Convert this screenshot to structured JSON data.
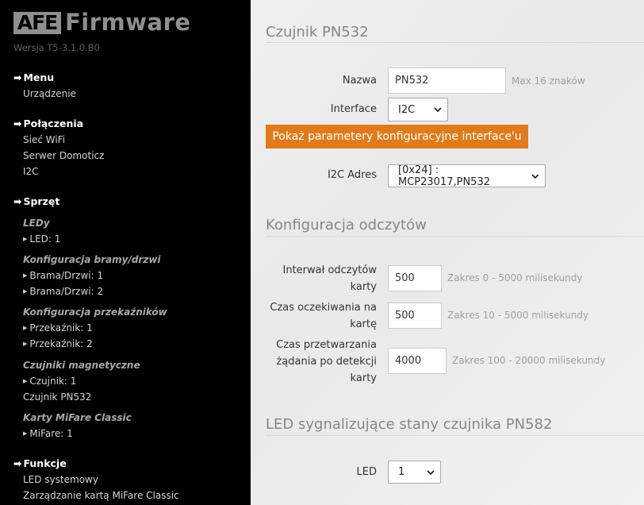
{
  "sidebar": {
    "logo_box": "AFE",
    "logo_word": "Firmware",
    "version": "Wersja T5-3.1.0.B0",
    "sections": {
      "menu": {
        "title": "Menu",
        "items": [
          "Urządzenie"
        ]
      },
      "connections": {
        "title": "Połączenia",
        "items": [
          "Sieć WiFi",
          "Serwer Domoticz",
          "I2C"
        ]
      },
      "hardware": {
        "title": "Sprzęt",
        "groups": [
          {
            "title": "LEDy",
            "items": [
              "LED: 1"
            ]
          },
          {
            "title": "Konfiguracja bramy/drzwi",
            "items": [
              "Brama/Drzwi: 1",
              "Brama/Drzwi: 2"
            ]
          },
          {
            "title": "Konfiguracja przekaźników",
            "items": [
              "Przekaźnik: 1",
              "Przekaźnik: 2"
            ]
          },
          {
            "title": "Czujniki magnetyczne",
            "items": [
              "Czujnik: 1"
            ],
            "link": "Czujnik PN532"
          },
          {
            "title": "Karty MiFare Classic",
            "items": [
              "MiFare: 1"
            ]
          }
        ]
      },
      "functions": {
        "title": "Funkcje",
        "items": [
          "LED systemowy",
          "Zarządzanie kartą MiFare Classic"
        ]
      }
    }
  },
  "main": {
    "section1": {
      "title": "Czujnik PN532",
      "name_label": "Nazwa",
      "name_value": "PN532",
      "name_hint": "Max 16 znaków",
      "interface_label": "Interface",
      "interface_value": "I2C",
      "show_params_button": "Pokaż parametery konfiguracyjne interface'u",
      "i2c_label": "I2C Adres",
      "i2c_value": "[0x24] : MCP23017,PN532"
    },
    "section2": {
      "title": "Konfiguracja odczytów",
      "interval_label": "Interwał odczytów karty",
      "interval_value": "500",
      "interval_hint": "Zakres 0 - 5000 milisekundy",
      "wait_label": "Czas oczekiwania na kartę",
      "wait_value": "500",
      "wait_hint": "Zakres 10 - 5000 milisekundy",
      "process_label": "Czas przetwarzania żądania po detekcji karty",
      "process_value": "4000",
      "process_hint": "Zakres 100 - 20000 milisekundy"
    },
    "section3": {
      "title": "LED sygnalizujące stany czujnika PN582",
      "led_label": "LED",
      "led_value": "1"
    }
  },
  "colors": {
    "accent": "#e07a1a",
    "sidebar_bg": "#000000",
    "logo_gray": "#8f8f8f"
  }
}
